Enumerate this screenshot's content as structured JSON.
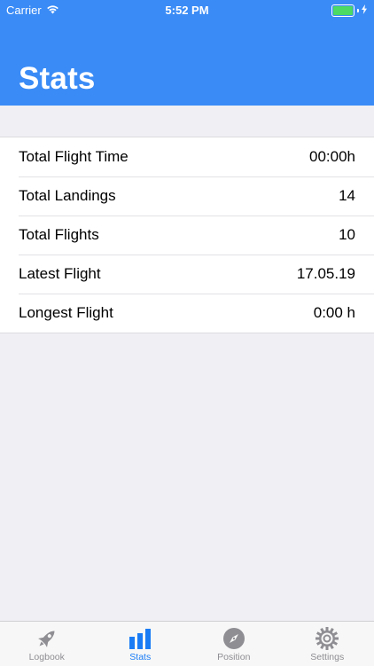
{
  "status_bar": {
    "carrier": "Carrier",
    "time": "5:52 PM",
    "battery_level": 1.0,
    "battery_color": "#4cd964"
  },
  "header": {
    "title": "Stats",
    "color": "#3a8bf6"
  },
  "stats": [
    {
      "label": "Total Flight Time",
      "value": "00:00h"
    },
    {
      "label": "Total Landings",
      "value": "14"
    },
    {
      "label": "Total Flights",
      "value": "10"
    },
    {
      "label": "Latest Flight",
      "value": "17.05.19"
    },
    {
      "label": "Longest Flight",
      "value": "0:00 h"
    }
  ],
  "tab_bar": {
    "active_color": "#1a7cf5",
    "tabs": [
      {
        "label": "Logbook",
        "icon": "rocket-icon",
        "active": false
      },
      {
        "label": "Stats",
        "icon": "bar-chart-icon",
        "active": true
      },
      {
        "label": "Position",
        "icon": "compass-icon",
        "active": false
      },
      {
        "label": "Settings",
        "icon": "gear-icon",
        "active": false
      }
    ]
  }
}
